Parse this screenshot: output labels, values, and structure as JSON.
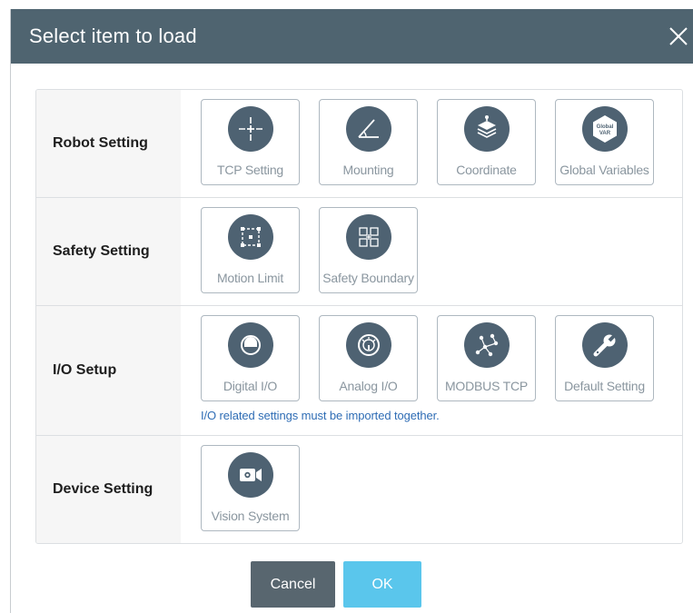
{
  "dialog": {
    "title": "Select item to load",
    "close_icon": "close-icon"
  },
  "sections": [
    {
      "label": "Robot Setting",
      "items": [
        {
          "label": "TCP Setting",
          "icon": "tcp-icon"
        },
        {
          "label": "Mounting",
          "icon": "mounting-angle-icon"
        },
        {
          "label": "Coordinate",
          "icon": "coordinate-icon"
        },
        {
          "label": "Global Variables",
          "icon": "global-var-icon",
          "icon_text": [
            "Global",
            "VAR"
          ]
        }
      ]
    },
    {
      "label": "Safety Setting",
      "items": [
        {
          "label": "Motion Limit",
          "icon": "motion-limit-icon"
        },
        {
          "label": "Safety Boundary",
          "icon": "safety-boundary-icon"
        }
      ]
    },
    {
      "label": "I/O Setup",
      "items": [
        {
          "label": "Digital I/O",
          "icon": "digital-io-icon"
        },
        {
          "label": "Analog I/O",
          "icon": "analog-io-icon"
        },
        {
          "label": "MODBUS TCP",
          "icon": "modbus-network-icon"
        },
        {
          "label": "Default Setting",
          "icon": "wrench-icon"
        }
      ],
      "note": "I/O related settings must be imported together."
    },
    {
      "label": "Device Setting",
      "items": [
        {
          "label": "Vision System",
          "icon": "vision-camera-icon"
        }
      ]
    }
  ],
  "buttons": {
    "cancel": "Cancel",
    "ok": "OK"
  },
  "colors": {
    "titlebar": "#4f6470",
    "icon_circle": "#4e6272",
    "note_text": "#2f6db5",
    "cancel_bg": "#58666f",
    "ok_bg": "#5ac6ec"
  }
}
